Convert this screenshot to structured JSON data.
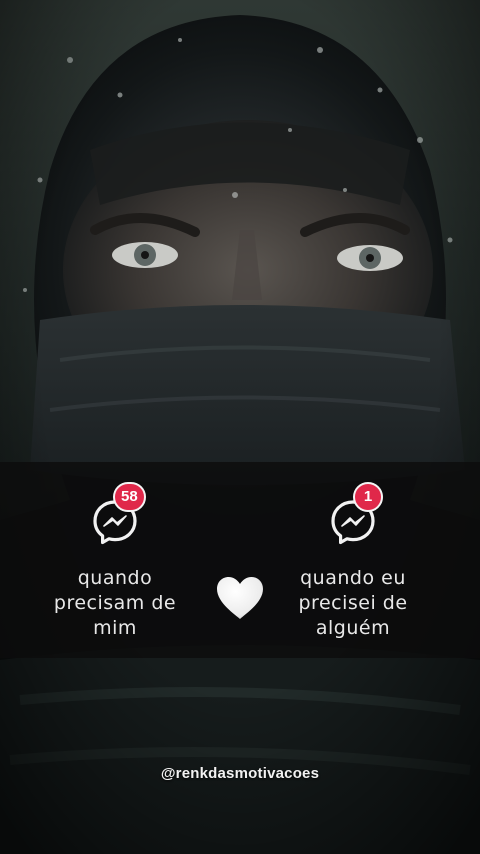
{
  "background": {
    "description_icon": "hooded-masked-man-photo"
  },
  "left": {
    "badge_count": "58",
    "icon": "messenger-icon",
    "caption": "quando\nprecisam de\nmim"
  },
  "center": {
    "icon": "white-heart-icon"
  },
  "right": {
    "badge_count": "1",
    "icon": "messenger-icon",
    "caption": "quando eu\nprecisei de\nalguém"
  },
  "watermark": {
    "handle": "@renkdasmotivacoes"
  },
  "colors": {
    "badge": "#e0284a",
    "text": "#e8e8e8",
    "overlay": "#0c0c0c"
  }
}
